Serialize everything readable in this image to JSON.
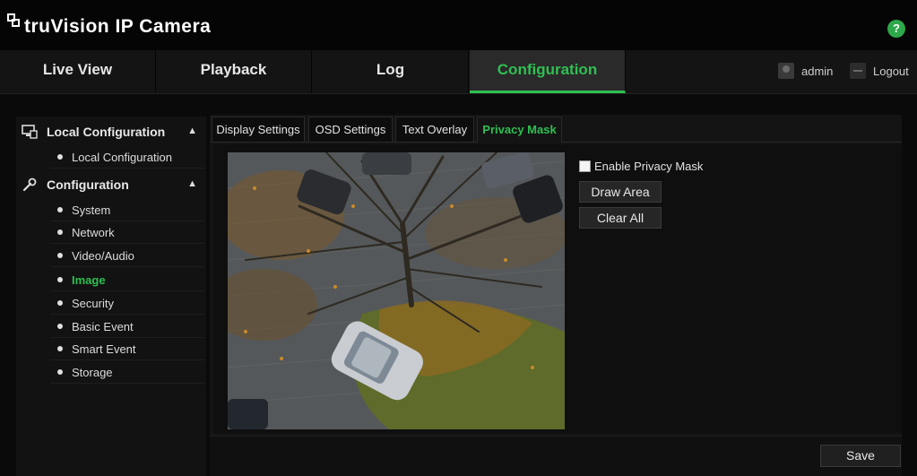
{
  "header": {
    "title": "truVision IP Camera",
    "help_label": "?"
  },
  "nav": {
    "tabs": [
      {
        "label": "Live View"
      },
      {
        "label": "Playback"
      },
      {
        "label": "Log"
      },
      {
        "label": "Configuration"
      }
    ],
    "active_tab": "Configuration",
    "user_label": "admin",
    "logout_label": "Logout"
  },
  "sidebar": {
    "local_section": {
      "title": "Local Configuration",
      "items": [
        {
          "label": "Local Configuration"
        }
      ]
    },
    "config_section": {
      "title": "Configuration",
      "items": [
        {
          "label": "System"
        },
        {
          "label": "Network"
        },
        {
          "label": "Video/Audio"
        },
        {
          "label": "Image"
        },
        {
          "label": "Security"
        },
        {
          "label": "Basic Event"
        },
        {
          "label": "Smart Event"
        },
        {
          "label": "Storage"
        }
      ]
    },
    "active_item": "Image"
  },
  "subtabs": [
    {
      "label": "Display Settings"
    },
    {
      "label": "OSD Settings"
    },
    {
      "label": "Text Overlay"
    },
    {
      "label": "Privacy Mask"
    }
  ],
  "active_subtab": "Privacy Mask",
  "privacy": {
    "enable_label": "Enable Privacy Mask",
    "enabled": false,
    "draw_area_label": "Draw Area",
    "clear_all_label": "Clear All"
  },
  "save_label": "Save",
  "colors": {
    "accent": "#2fbf52",
    "background": "#0a0a0a"
  }
}
